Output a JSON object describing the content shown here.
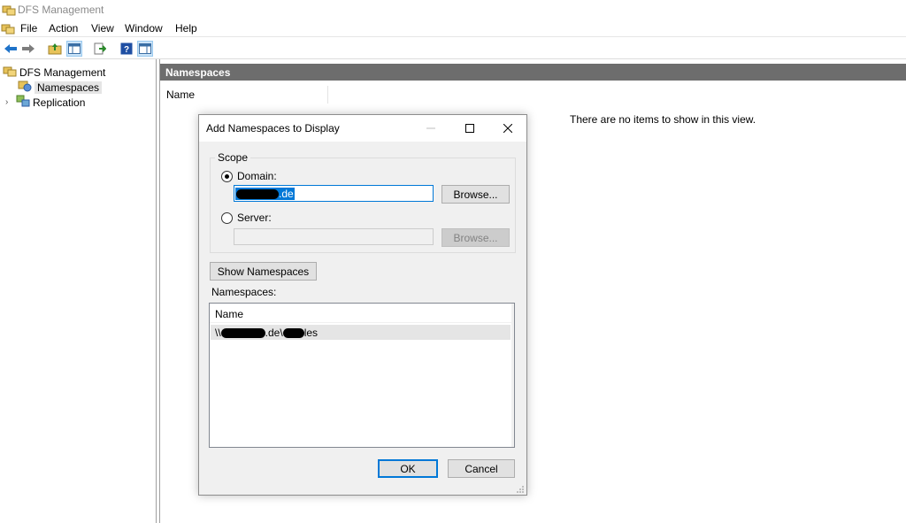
{
  "window": {
    "title": "DFS Management"
  },
  "menu": [
    "File",
    "Action",
    "View",
    "Window",
    "Help"
  ],
  "toolbar": [
    "back-icon",
    "forward-icon",
    "up-folder-icon",
    "show-tree-icon",
    "export-list-icon",
    "help-icon",
    "properties-icon"
  ],
  "tree": {
    "root": "DFS Management",
    "items": [
      {
        "label": "Namespaces",
        "selected": true
      },
      {
        "label": "Replication",
        "selected": false
      }
    ]
  },
  "panel": {
    "header": "Namespaces",
    "column": "Name",
    "empty_message": "There are no items to show in this view."
  },
  "dialog": {
    "title": "Add Namespaces to Display",
    "scope_label": "Scope",
    "domain_label": "Domain:",
    "domain_value_suffix": ".de",
    "server_label": "Server:",
    "server_value": "",
    "browse_label": "Browse...",
    "show_namespaces_label": "Show Namespaces",
    "namespaces_label": "Namespaces:",
    "list_column": "Name",
    "list_rows": [
      {
        "prefix": "\\\\",
        "part2": ".de\\",
        "suffix": "les"
      }
    ],
    "ok_label": "OK",
    "cancel_label": "Cancel"
  }
}
